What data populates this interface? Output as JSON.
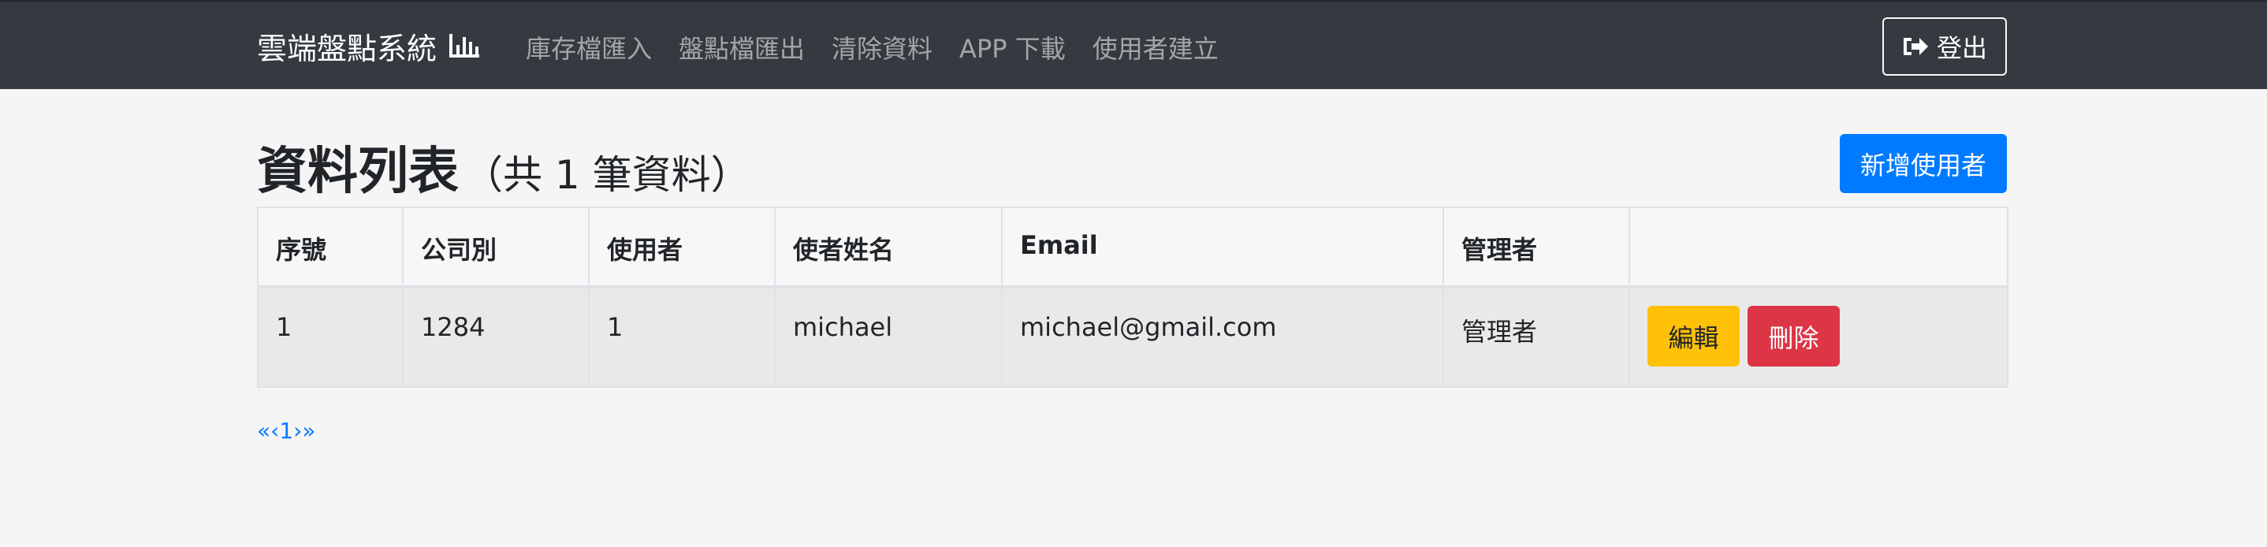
{
  "navbar": {
    "brand": "雲端盤點系統",
    "brand_icon": "bar-chart-icon",
    "links": [
      {
        "label": "庫存檔匯入"
      },
      {
        "label": "盤點檔匯出"
      },
      {
        "label": "清除資料"
      },
      {
        "label": "APP 下載"
      },
      {
        "label": "使用者建立"
      }
    ],
    "logout_label": "登出",
    "logout_icon": "sign-out-icon"
  },
  "page": {
    "title": "資料列表",
    "count_text": "（共 1 筆資料）",
    "add_user_label": "新增使用者"
  },
  "table": {
    "headers": [
      "序號",
      "公司別",
      "使用者",
      "使者姓名",
      "Email",
      "管理者",
      ""
    ],
    "rows": [
      {
        "cells": [
          "1",
          "1284",
          "1",
          "michael",
          "michael@gmail.com",
          "管理者"
        ],
        "edit_label": "編輯",
        "delete_label": "刪除"
      }
    ]
  },
  "pagination": {
    "first": "«",
    "prev": "‹",
    "current": "1",
    "next": "›",
    "last": "»"
  },
  "colors": {
    "navbar_bg": "#343a40",
    "primary": "#007bff",
    "warning": "#ffc107",
    "danger": "#dc3545",
    "page_bg": "#f5f5f5"
  }
}
